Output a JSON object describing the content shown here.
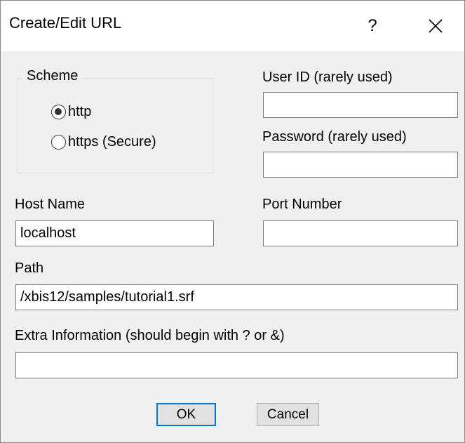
{
  "window": {
    "title": "Create/Edit URL",
    "help_glyph": "?"
  },
  "scheme": {
    "legend": "Scheme",
    "options": [
      {
        "label": "http",
        "selected": true
      },
      {
        "label": "https (Secure)",
        "selected": false
      }
    ]
  },
  "fields": {
    "user_id": {
      "label": "User ID (rarely used)",
      "value": ""
    },
    "password": {
      "label": "Password (rarely used)",
      "value": ""
    },
    "host_name": {
      "label": "Host Name",
      "value": "localhost"
    },
    "port_number": {
      "label": "Port Number",
      "value": ""
    },
    "path": {
      "label": "Path",
      "value": "/xbis12/samples/tutorial1.srf"
    },
    "extra_info": {
      "label": "Extra Information (should begin with ? or &)",
      "value": ""
    }
  },
  "buttons": {
    "ok": "OK",
    "cancel": "Cancel"
  },
  "colors": {
    "dialog_bg": "#f0f0f0",
    "titlebar_bg": "#ffffff",
    "default_button_border": "#0078d7"
  },
  "icons": {
    "close": "close-icon",
    "radio_selected": "radio-selected-icon",
    "radio_unselected": "radio-unselected-icon"
  }
}
